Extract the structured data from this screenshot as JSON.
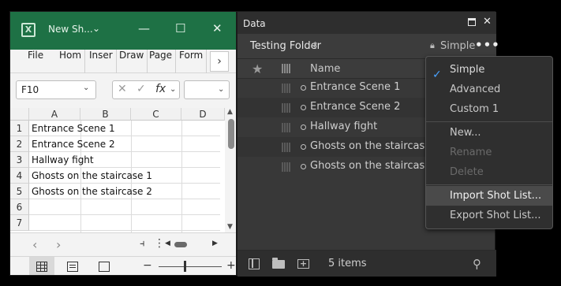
{
  "excel": {
    "title": "New Sh...",
    "ribbon_tabs": [
      "File",
      "Hom",
      "Inser",
      "Draw",
      "Page",
      "Form"
    ],
    "ribbon_more": "›",
    "namebox": "F10",
    "columns": [
      "A",
      "B",
      "C",
      "D"
    ],
    "rows": [
      {
        "num": "1",
        "a": "Entrance Scene 1"
      },
      {
        "num": "2",
        "a": "Entrance Scene 2"
      },
      {
        "num": "3",
        "a": "Hallway fight"
      },
      {
        "num": "4",
        "a": "Ghosts on the staircase 1"
      },
      {
        "num": "5",
        "a": "Ghosts on the staircase 2"
      },
      {
        "num": "6",
        "a": ""
      },
      {
        "num": "7",
        "a": ""
      }
    ]
  },
  "data_panel": {
    "title": "Data",
    "folder": "Testing Folder",
    "mode": "Simple",
    "column_name": "Name",
    "items": [
      "Entrance Scene 1",
      "Entrance Scene 2",
      "Hallway fight",
      "Ghosts on the staircase 1",
      "Ghosts on the staircase 2"
    ],
    "count": "5 items"
  },
  "menu": {
    "items": [
      {
        "label": "Simple",
        "checked": true,
        "disabled": false
      },
      {
        "label": "Advanced",
        "disabled": false
      },
      {
        "label": "Custom 1",
        "disabled": false
      },
      {
        "label": "New...",
        "disabled": false
      },
      {
        "label": "Rename",
        "disabled": true
      },
      {
        "label": "Delete",
        "disabled": true
      },
      {
        "label": "Import Shot List...",
        "disabled": false,
        "highlighted": true
      },
      {
        "label": "Export Shot List...",
        "disabled": false
      }
    ]
  },
  "colors": {
    "excel_green": "#1e7145",
    "panel_bg": "#383838",
    "check_blue": "#4aa3ff"
  }
}
